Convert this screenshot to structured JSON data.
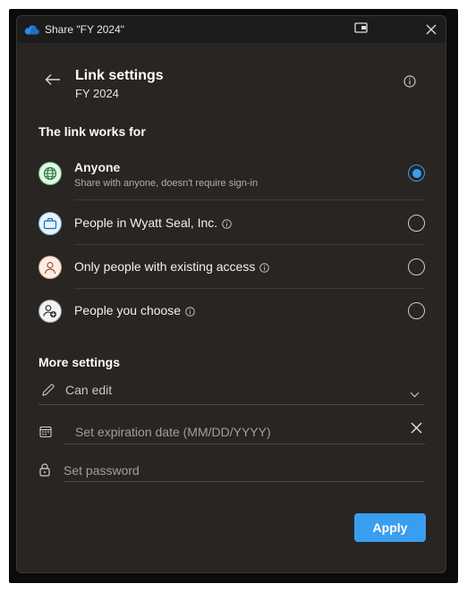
{
  "window": {
    "title": "Share \"FY 2024\"",
    "icons": [
      "onedrive-cloud-icon",
      "picture-in-picture-icon",
      "close-icon"
    ]
  },
  "header": {
    "title": "Link settings",
    "subtitle": "FY 2024",
    "icons": [
      "back-arrow-icon",
      "info-icon"
    ]
  },
  "link_works_for": {
    "heading": "The link works for",
    "options": [
      {
        "label": "Anyone",
        "description": "Share with anyone, doesn't require sign-in",
        "selected": true,
        "icon": "globe-icon",
        "has_info": false
      },
      {
        "label": "People in Wyatt Seal, Inc.",
        "selected": false,
        "icon": "briefcase-icon",
        "has_info": true
      },
      {
        "label": "Only people with existing access",
        "selected": false,
        "icon": "person-icon",
        "has_info": true
      },
      {
        "label": "People you choose",
        "selected": false,
        "icon": "person-add-icon",
        "has_info": true
      }
    ]
  },
  "more_settings": {
    "heading": "More settings",
    "permission": {
      "value": "Can edit",
      "icon": "pencil-icon"
    },
    "expiration": {
      "placeholder": "Set expiration date (MM/DD/YYYY)",
      "icon": "calendar-icon"
    },
    "password": {
      "placeholder": "Set password",
      "icon": "lock-icon"
    }
  },
  "actions": {
    "apply_label": "Apply"
  },
  "colors": {
    "accent": "#3a9ef0",
    "background": "#282522",
    "titlebar": "#1c1c1c"
  }
}
